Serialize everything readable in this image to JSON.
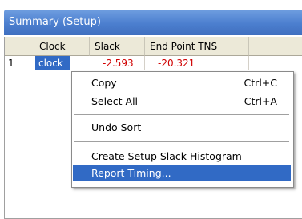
{
  "window": {
    "title": "Summary (Setup)"
  },
  "table": {
    "columns": [
      "",
      "Clock",
      "Slack",
      "End Point TNS"
    ],
    "rows": [
      {
        "index": "1",
        "clock": "clock",
        "slack": "-2.593",
        "tns": "-20.321"
      }
    ]
  },
  "context_menu": {
    "copy": {
      "label": "Copy",
      "shortcut": "Ctrl+C"
    },
    "select_all": {
      "label": "Select All",
      "shortcut": "Ctrl+A"
    },
    "undo_sort": {
      "label": "Undo Sort"
    },
    "histogram": {
      "label": "Create Setup Slack Histogram"
    },
    "report_timing": {
      "label": "Report Timing..."
    }
  },
  "colors": {
    "title_bar": "#4c7fcf",
    "selection": "#316ac5",
    "negative": "#d00000",
    "header": "#ece9d8"
  }
}
